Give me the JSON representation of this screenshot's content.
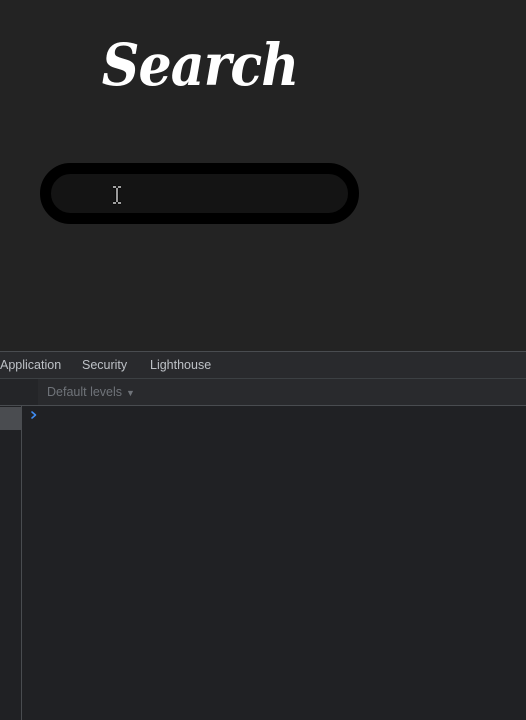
{
  "webpage": {
    "title": "Search",
    "search_input": {
      "value": "",
      "placeholder": ""
    }
  },
  "devtools": {
    "tabs": [
      {
        "label": "Application"
      },
      {
        "label": "Security"
      },
      {
        "label": "Lighthouse"
      }
    ],
    "toolbar": {
      "levels_label": "Default levels",
      "levels_arrow": "▼"
    },
    "console": {
      "prompt_icon": "chevron-right-icon"
    }
  },
  "colors": {
    "page_background": "#232323",
    "title_text": "#ffffff",
    "search_border": "#000000",
    "devtools_background": "#202124",
    "tab_text": "#bdc1c6",
    "prompt_accent": "#3f8cf3"
  }
}
